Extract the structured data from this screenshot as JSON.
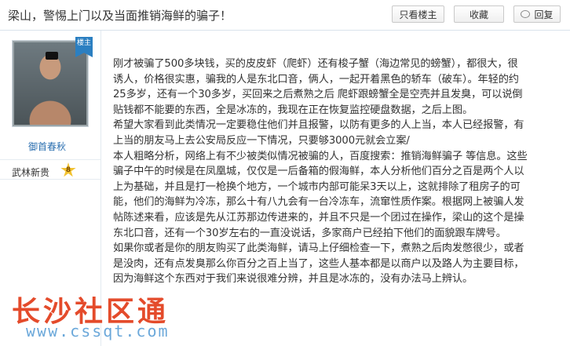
{
  "thread": {
    "title": "梁山，警惕上门以及当面推销海鲜的骗子！"
  },
  "toolbar": {
    "only_op_label": "只看楼主",
    "favorite_label": "收藏",
    "reply_label": "回复"
  },
  "author": {
    "op_badge": "楼主",
    "username": "御首春秋",
    "rank_title": "武林新贵",
    "rank_level": "8"
  },
  "post": {
    "lines": [
      "刚才被骗了500多块钱，买的皮皮虾（爬虾）还有梭子蟹（海边常见的螃蟹），都很大，很",
      "诱人，价格很实惠，骗我的人是东北口音，俩人，一起开着黑色的轿车（破车）。年轻的约",
      "25多岁，还有一个30多岁，买回来之后煮熟之后 爬虾跟螃蟹全是空壳并且发臭，可以说倒",
      "贴钱都不能要的东西，全是冰冻的，我现在正在恢复监控硬盘数据，之后上图。",
      "希望大家看到此类情况一定要稳住他们并且报警，以防有更多的人上当，本人已经报警，有",
      "上当的朋友马上去公安局反应一下情况，只要够3000元就会立案/",
      "本人粗略分析，网络上有不少被类似情况被骗的人，百度搜索：推销海鲜骗子 等信息。这些",
      "骗子中午的时候是在凤凰城，仅仅是一后备箱的假海鲜，本人分析他们百分之百是两个人以",
      "上为基础，并且是打一枪换个地方，一个城市内部可能呆3天以上，这就排除了租房子的可",
      "能，他们的海鲜为冷冻，那么十有八九会有一台冷冻车，流窜性质作案。根据网上被骗人发",
      "帖陈述来看，应该是先从江苏那边传进来的，并且不只是一个团过在操作，梁山的这个是操",
      "东北口音，还有一个30岁左右的一直没说话，多家商户已经拍下他们的面貌跟车牌号。",
      "如果你或者是你的朋友购买了此类海鲜，请马上仔细检查一下，煮熟之后肉发憋很少，或者",
      "是没肉，还有点发臭那么你百分之百上当了，这些人基本都是以商户以及路人为主要目标，",
      "因为海鲜这个东西对于我们来说很难分辨，并且是冰冻的，没有办法马上辨认。"
    ]
  },
  "watermark": {
    "text": "长沙社区通",
    "url": "www.cssqt.com"
  }
}
